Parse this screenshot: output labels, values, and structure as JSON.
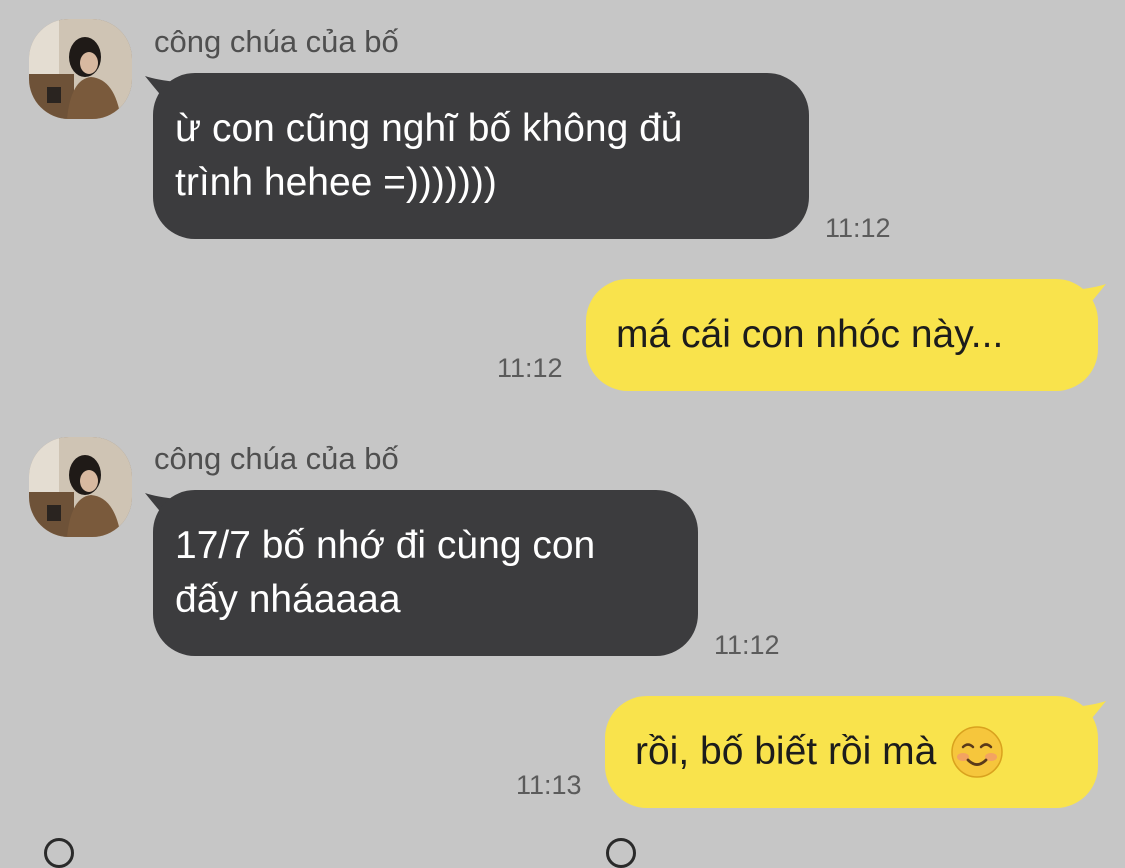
{
  "colors": {
    "background": "#c6c6c6",
    "incoming_bubble": "#3c3c3e",
    "outgoing_bubble": "#f9e34c"
  },
  "messages": [
    {
      "direction": "incoming",
      "sender": "công chúa của bố",
      "text_lines": [
        "ừ con cũng nghĩ bố không đủ",
        "trình hehee =)))))))"
      ],
      "time": "11:12"
    },
    {
      "direction": "outgoing",
      "text": "má cái con nhóc này...",
      "time": "11:12"
    },
    {
      "direction": "incoming",
      "sender": "công chúa của bố",
      "text_lines": [
        "17/7 bố nhớ đi cùng con",
        "đấy nháaaaa"
      ],
      "time": "11:12"
    },
    {
      "direction": "outgoing",
      "text": "rồi, bố biết rồi mà",
      "emoji_icon": "smiling-face-icon",
      "time": "11:13"
    }
  ]
}
